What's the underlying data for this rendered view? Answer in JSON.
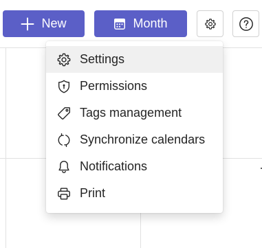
{
  "toolbar": {
    "new_label": "New",
    "month_label": "Month",
    "new_icon": "plus-icon",
    "month_icon": "calendar-icon",
    "settings_icon": "gear-icon",
    "help_icon": "help-circle-icon"
  },
  "settings_menu": {
    "items": [
      {
        "label": "Settings",
        "icon": "gear-icon",
        "active": true
      },
      {
        "label": "Permissions",
        "icon": "shield-icon",
        "active": false
      },
      {
        "label": "Tags management",
        "icon": "tag-icon",
        "active": false
      },
      {
        "label": "Synchronize calendars",
        "icon": "sync-icon",
        "active": false
      },
      {
        "label": "Notifications",
        "icon": "bell-icon",
        "active": false
      },
      {
        "label": "Print",
        "icon": "printer-icon",
        "active": false
      }
    ]
  },
  "colors": {
    "primary": "#5b5fc7",
    "hover_bg": "#f0f0f0",
    "grid_line": "#e1e1e1"
  }
}
